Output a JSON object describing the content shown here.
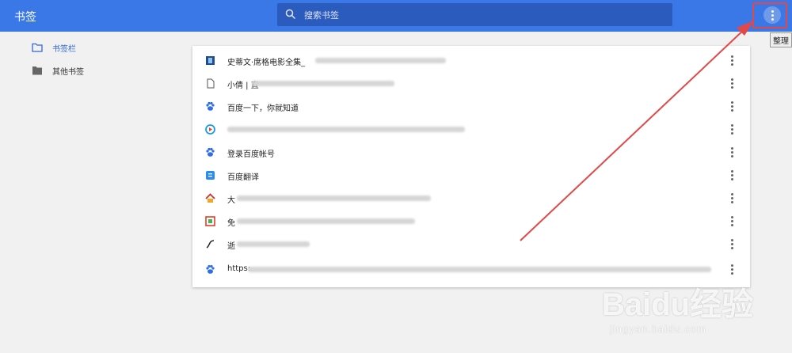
{
  "header": {
    "title": "书签",
    "search_placeholder": "搜索书签",
    "menu_tooltip": "整理"
  },
  "sidebar": {
    "items": [
      {
        "label": "书签栏",
        "icon": "folder-outline-icon"
      },
      {
        "label": "其他书签",
        "icon": "folder-filled-icon"
      }
    ]
  },
  "bookmarks": [
    {
      "title": "史蒂文·席格电影全集_",
      "icon": "film-icon"
    },
    {
      "title": "小倩 | 直",
      "icon": "page-icon"
    },
    {
      "title": "百度一下，你就知道",
      "icon": "baidu-paw-icon"
    },
    {
      "title": "",
      "icon": "video-play-icon"
    },
    {
      "title": "登录百度帐号",
      "icon": "baidu-paw-icon"
    },
    {
      "title": "百度翻译",
      "icon": "translate-icon"
    },
    {
      "title": "大",
      "icon": "house-icon"
    },
    {
      "title": "免",
      "icon": "grid-icon"
    },
    {
      "title": "逝",
      "icon": "brush-icon"
    },
    {
      "title": "https:",
      "icon": "baidu-paw-icon"
    }
  ],
  "watermark": {
    "brand": "Baidu经验",
    "url": "jingyan.baidu.com"
  },
  "colors": {
    "topbar": "#3b78e7",
    "accent": "#3367d6",
    "annotation": "#e34848"
  }
}
